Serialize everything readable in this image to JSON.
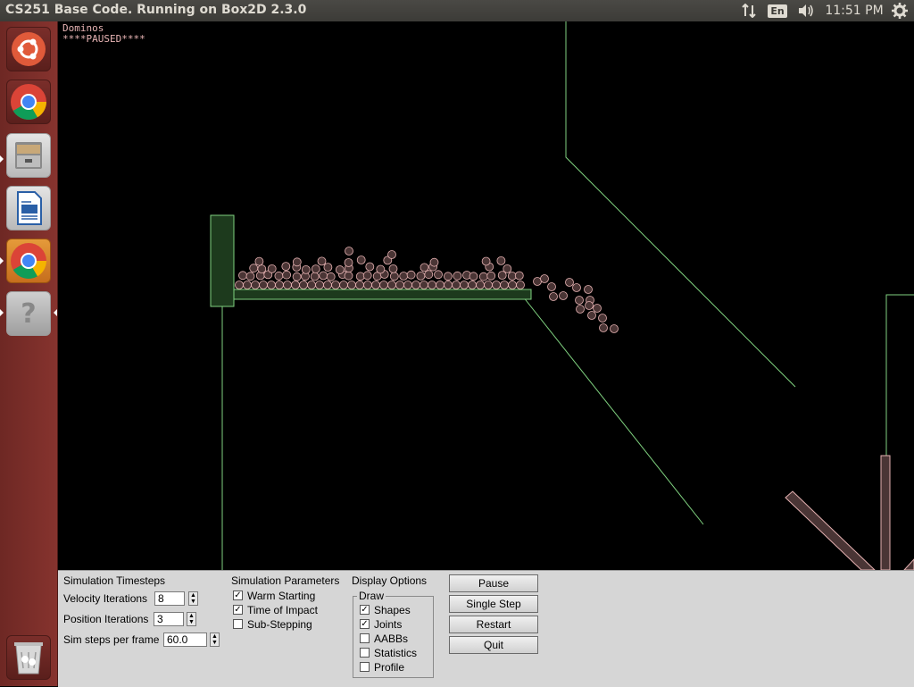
{
  "window": {
    "title": "CS251 Base Code. Running on Box2D 2.3.0"
  },
  "tray": {
    "network_icon": "network-arrows-icon",
    "language": "En",
    "volume_icon": "speaker-icon",
    "clock": "11:51 PM",
    "settings_icon": "gear-icon"
  },
  "launcher": {
    "items": [
      {
        "name": "ubuntu-dash",
        "icon": "ubuntu-logo-icon"
      },
      {
        "name": "chrome",
        "icon": "chrome-icon"
      },
      {
        "name": "files",
        "icon": "file-cabinet-icon"
      },
      {
        "name": "writer",
        "icon": "document-icon"
      },
      {
        "name": "chrome-running",
        "icon": "chrome-icon"
      },
      {
        "name": "unknown-app",
        "icon": "question-mark-icon",
        "label": "?"
      },
      {
        "name": "trash",
        "icon": "trash-icon"
      }
    ]
  },
  "simulation": {
    "title": "Dominos",
    "status": "****PAUSED****",
    "colors": {
      "background": "#000000",
      "static_lines": "#7fd17f",
      "dynamic_fill": "#4a3535",
      "dynamic_outline": "#e5b2b2",
      "text": "#e8b4b4"
    }
  },
  "panel": {
    "timesteps": {
      "heading": "Simulation Timesteps",
      "velocity_label": "Velocity Iterations",
      "velocity_value": "8",
      "position_label": "Position Iterations",
      "position_value": "3",
      "steps_label": "Sim steps per frame",
      "steps_value": "60.0"
    },
    "parameters": {
      "heading": "Simulation Parameters",
      "options": [
        {
          "label": "Warm Starting",
          "checked": true
        },
        {
          "label": "Time of Impact",
          "checked": true
        },
        {
          "label": "Sub-Stepping",
          "checked": false
        }
      ]
    },
    "display": {
      "heading": "Display Options",
      "group": "Draw",
      "options": [
        {
          "label": "Shapes",
          "checked": true
        },
        {
          "label": "Joints",
          "checked": true
        },
        {
          "label": "AABBs",
          "checked": false
        },
        {
          "label": "Statistics",
          "checked": false
        },
        {
          "label": "Profile",
          "checked": false
        }
      ]
    },
    "buttons": {
      "pause": "Pause",
      "single_step": "Single Step",
      "restart": "Restart",
      "quit": "Quit"
    }
  }
}
